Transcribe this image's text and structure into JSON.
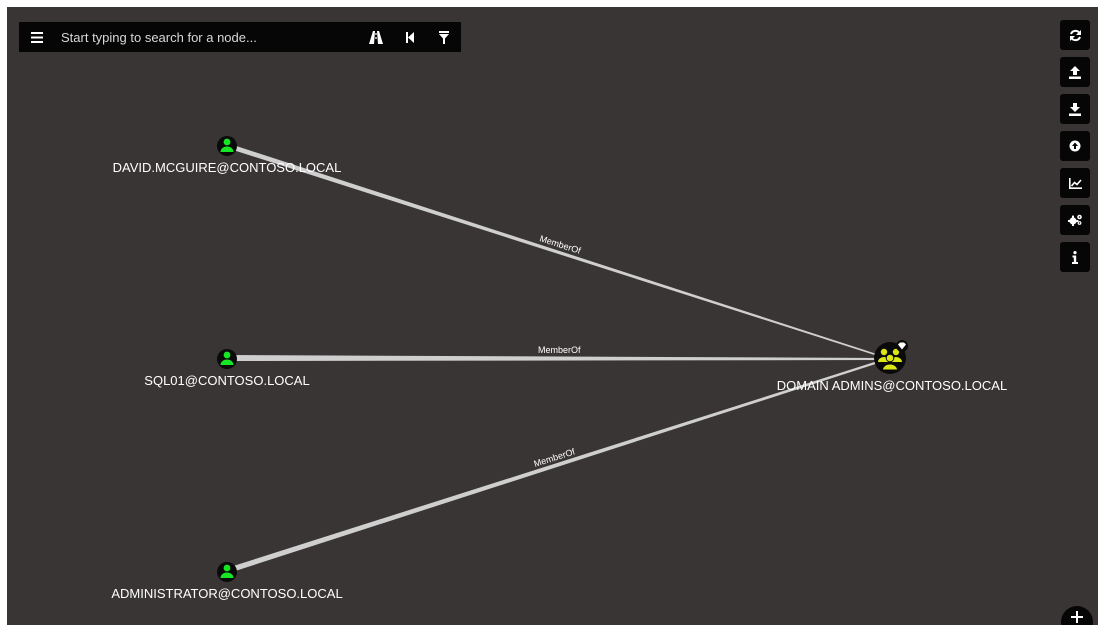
{
  "search": {
    "placeholder": "Start typing to search for a node..."
  },
  "search_bar_buttons": [
    {
      "name": "menu-icon"
    },
    {
      "name": "pathfinding-icon"
    },
    {
      "name": "back-icon"
    },
    {
      "name": "filter-icon"
    }
  ],
  "toolbar": [
    {
      "name": "refresh-icon"
    },
    {
      "name": "upload-icon"
    },
    {
      "name": "download-icon"
    },
    {
      "name": "upload-circle-icon"
    },
    {
      "name": "chart-icon"
    },
    {
      "name": "settings-icon"
    },
    {
      "name": "info-icon"
    }
  ],
  "graph": {
    "nodes": [
      {
        "id": "david",
        "label": "DAVID.MCGUIRE@CONTOSO.LOCAL",
        "type": "user",
        "color": "#17e625"
      },
      {
        "id": "sql01",
        "label": "SQL01@CONTOSO.LOCAL",
        "type": "user",
        "color": "#17e625"
      },
      {
        "id": "admin",
        "label": "ADMINISTRATOR@CONTOSO.LOCAL",
        "type": "user",
        "color": "#17e625"
      },
      {
        "id": "domainadmins",
        "label": "DOMAIN ADMINS@CONTOSO.LOCAL",
        "type": "group",
        "color": "#dbe617",
        "highvalue": true
      }
    ],
    "edges": [
      {
        "source": "david",
        "target": "domainadmins",
        "label": "MemberOf"
      },
      {
        "source": "sql01",
        "target": "domainadmins",
        "label": "MemberOf"
      },
      {
        "source": "admin",
        "target": "domainadmins",
        "label": "MemberOf"
      }
    ]
  },
  "colors": {
    "background": "#3a3535",
    "toolbar": "#060606",
    "edge": "#cfcfcf",
    "link": "#2a5bd7"
  }
}
